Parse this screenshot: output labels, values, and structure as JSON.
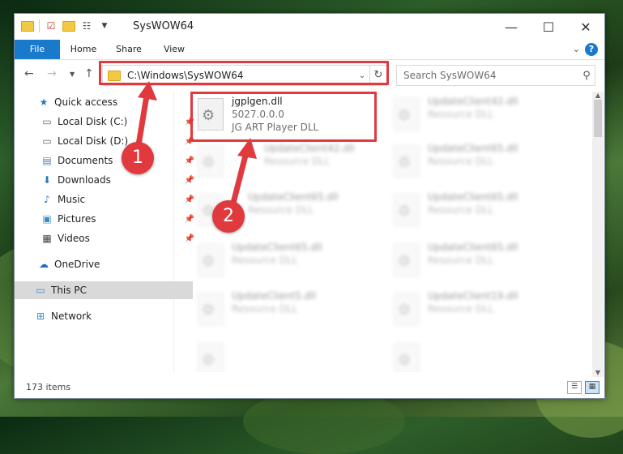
{
  "window": {
    "title": "SysWOW64",
    "controls": {
      "minimize": "—",
      "maximize": "☐",
      "close": "✕"
    }
  },
  "ribbon": {
    "tabs": [
      "File",
      "Home",
      "Share",
      "View"
    ],
    "help": "?"
  },
  "nav": {
    "address": "C:\\Windows\\SysWOW64",
    "search_placeholder": "Search SysWOW64"
  },
  "sidebar": {
    "items": [
      {
        "label": "Quick access",
        "icon": "star-icon"
      },
      {
        "label": "Local Disk (C:)",
        "icon": "drive-icon",
        "pinned": true
      },
      {
        "label": "Local Disk (D:)",
        "icon": "drive-icon",
        "pinned": true
      },
      {
        "label": "Documents",
        "icon": "documents-icon",
        "pinned": true
      },
      {
        "label": "Downloads",
        "icon": "downloads-icon",
        "pinned": true
      },
      {
        "label": "Music",
        "icon": "music-icon",
        "pinned": true
      },
      {
        "label": "Pictures",
        "icon": "pictures-icon",
        "pinned": true
      },
      {
        "label": "Videos",
        "icon": "videos-icon",
        "pinned": true
      },
      {
        "label": "OneDrive",
        "icon": "onedrive-icon"
      },
      {
        "label": "This PC",
        "icon": "this-pc-icon",
        "selected": true
      },
      {
        "label": "Network",
        "icon": "network-icon"
      }
    ]
  },
  "files": {
    "featured": {
      "name": "jgplgen.dll",
      "version": "5027.0.0.0",
      "description": "JG ART Player DLL"
    },
    "others": [
      {
        "name": "UpdateClient42.dll",
        "description": "Resource DLL"
      },
      {
        "name": "UpdateClient42.dll",
        "description": "Resource DLL"
      },
      {
        "name": "UpdateClient65.dll",
        "description": "Resource DLL"
      },
      {
        "name": "UpdateClient65.dll",
        "description": "Resource DLL"
      },
      {
        "name": "UpdateClient65.dll",
        "description": "Resource DLL"
      },
      {
        "name": "UpdateClient65.dll",
        "description": "Resource DLL"
      },
      {
        "name": "UpdateClient65.dll",
        "description": "Resource DLL"
      },
      {
        "name": "UpdateClient5.dll",
        "description": "Resource DLL"
      },
      {
        "name": "UpdateClient19.dll",
        "description": "Resource DLL"
      }
    ]
  },
  "status": {
    "item_count": "173 items"
  },
  "annotations": {
    "step1": "1",
    "step2": "2",
    "color": "#e0393e"
  }
}
